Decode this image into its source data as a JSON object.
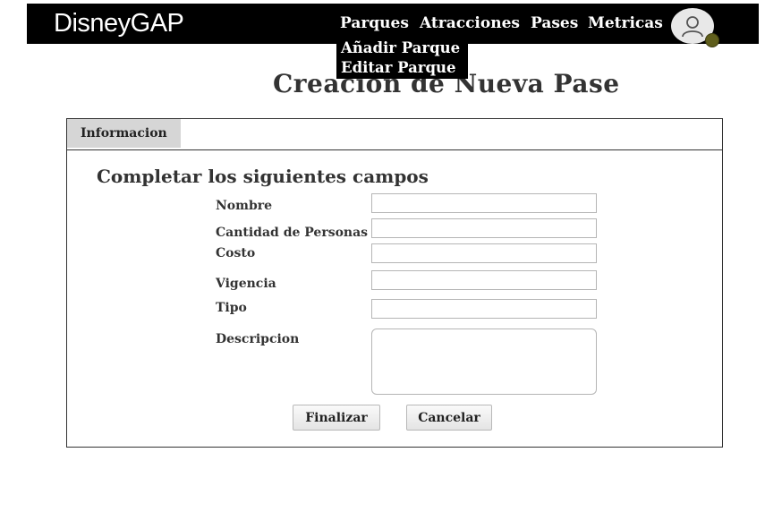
{
  "header": {
    "brand": "DisneyGAP",
    "nav": [
      "Parques",
      "Atracciones",
      "Pases",
      "Metricas"
    ],
    "avatar_icon": "user-icon"
  },
  "dropdown": {
    "items": [
      "Añadir Parque",
      "Editar Parque"
    ]
  },
  "page": {
    "title": "Creacion de Nueva Pase"
  },
  "form": {
    "tab": "Informacion",
    "heading": "Completar los siguientes campos",
    "fields": [
      {
        "label": "Nombre",
        "value": ""
      },
      {
        "label": "Cantidad de Personas",
        "value": ""
      },
      {
        "label": "Costo",
        "value": ""
      },
      {
        "label": "Vigencia",
        "value": ""
      },
      {
        "label": "Tipo",
        "value": ""
      },
      {
        "label": "Descripcion",
        "value": ""
      }
    ],
    "buttons": {
      "submit": "Finalizar",
      "cancel": "Cancelar"
    }
  }
}
